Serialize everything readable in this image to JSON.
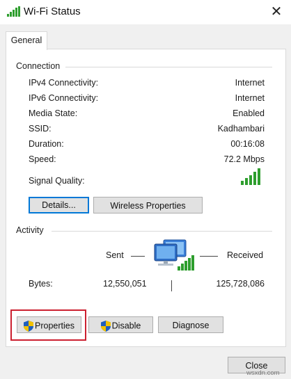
{
  "window": {
    "title": "Wi-Fi Status",
    "close_glyph": "✕"
  },
  "tabs": [
    {
      "label": "General"
    }
  ],
  "connection": {
    "heading": "Connection",
    "rows": [
      {
        "label": "IPv4 Connectivity:",
        "value": "Internet"
      },
      {
        "label": "IPv6 Connectivity:",
        "value": "Internet"
      },
      {
        "label": "Media State:",
        "value": "Enabled"
      },
      {
        "label": "SSID:",
        "value": "Kadhambari"
      },
      {
        "label": "Duration:",
        "value": "00:16:08"
      },
      {
        "label": "Speed:",
        "value": "72.2 Mbps"
      }
    ],
    "signal_label": "Signal Quality:",
    "signal_bars_filled": 5,
    "signal_bars_total": 5,
    "details_button": "Details...",
    "wireless_button": "Wireless Properties"
  },
  "activity": {
    "heading": "Activity",
    "sent_label": "Sent",
    "received_label": "Received",
    "bytes_label": "Bytes:",
    "bytes_sent": "12,550,051",
    "bytes_received": "125,728,086"
  },
  "actions": {
    "properties_button": "Properties",
    "disable_button": "Disable",
    "diagnose_button": "Diagnose"
  },
  "footer": {
    "close_button": "Close"
  },
  "watermark": "wsxdn.com",
  "icons": {
    "title": "wifi-signal-icon",
    "network": "network-computers-icon",
    "shield": "uac-shield-icon"
  },
  "colors": {
    "signal": "#2e9e2e",
    "default_button_border": "#0078d7",
    "highlight": "#cc2030"
  }
}
